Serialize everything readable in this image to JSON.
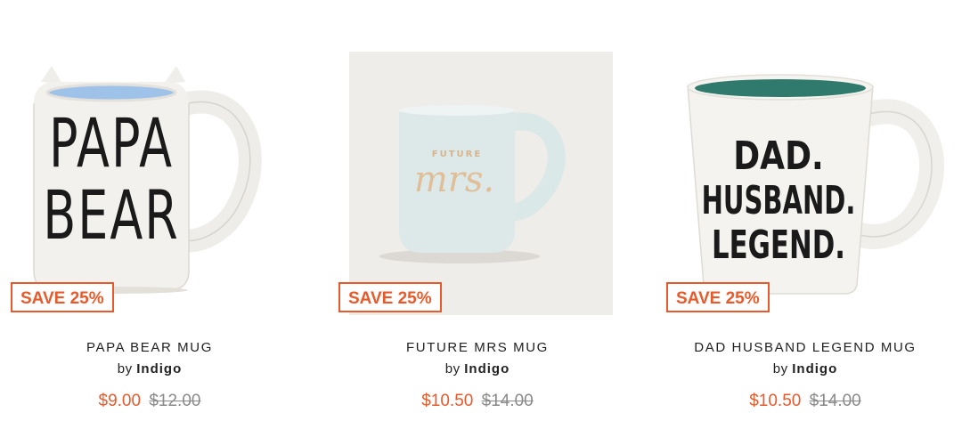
{
  "products": [
    {
      "badge": "SAVE 25%",
      "title": "PAPA BEAR MUG",
      "by": "by",
      "brand": "Indigo",
      "price": "$9.00",
      "original_price": "$12.00",
      "mug_text": [
        "PAPA",
        "BEAR"
      ]
    },
    {
      "badge": "SAVE 25%",
      "title": "FUTURE MRS MUG",
      "by": "by",
      "brand": "Indigo",
      "price": "$10.50",
      "original_price": "$14.00",
      "mug_text": [
        "FUTURE",
        "mrs."
      ]
    },
    {
      "badge": "SAVE 25%",
      "title": "DAD HUSBAND LEGEND MUG",
      "by": "by",
      "brand": "Indigo",
      "price": "$10.50",
      "original_price": "$14.00",
      "mug_text": [
        "DAD.",
        "HUSBAND.",
        "LEGEND."
      ]
    }
  ],
  "colors": {
    "accent": "#e85a2c",
    "strikethrough": "#8a8a8a",
    "text": "#222222"
  }
}
